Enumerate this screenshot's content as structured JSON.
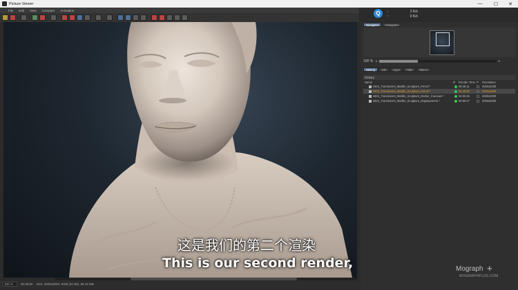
{
  "window": {
    "title": "Picture Viewer",
    "minimize": "—",
    "maximize": "☐",
    "close": "✕"
  },
  "menu": [
    "File",
    "Edit",
    "View",
    "Compare",
    "Animation"
  ],
  "stats": {
    "badge": "Q",
    "download": "2 K/s",
    "upload": "0 K/s"
  },
  "navigator": {
    "tabs": [
      "Navigator",
      "Histogram"
    ],
    "zoom": "100 %",
    "zoom_fraction": 0.33
  },
  "info_tabs": [
    "History",
    "Info",
    "Layer",
    "Filter",
    "Stereo"
  ],
  "history": {
    "title": "History",
    "columns": {
      "name": "Name",
      "r": "R",
      "render_time": "Render Time",
      "p": "P",
      "resolution": "Resolution"
    },
    "rows": [
      {
        "name": "0401_Translucent_Marble_Sculpture_Pencil *",
        "time": "00:46:11",
        "res": "2000x2000",
        "selected": false
      },
      {
        "name": "0401_Translucent_Marble_Sculpture_Pencil *",
        "time": "00:46:00",
        "res": "2000x2000",
        "selected": true
      },
      {
        "name": "0401_Translucent_Marble_Sculpture_Darker_Concave *",
        "time": "01:02:45",
        "res": "2000x2000",
        "selected": false
      },
      {
        "name": "0401_Translucent_Marble_Sculpture_Displacement *",
        "time": "00:50:47",
        "res": "2000x2000",
        "selected": false
      }
    ]
  },
  "status": {
    "zoom": "100 %",
    "time": "00:46:00",
    "size": "Size: 2000x2000, RGB (32 Bit), 96.15 MB"
  },
  "subtitles": {
    "cn": "这是我们的第二个渲染",
    "en": "This is our second render,"
  },
  "logo": {
    "main": "Mograph",
    "sub": "MOGRAPHPLUS.COM"
  }
}
